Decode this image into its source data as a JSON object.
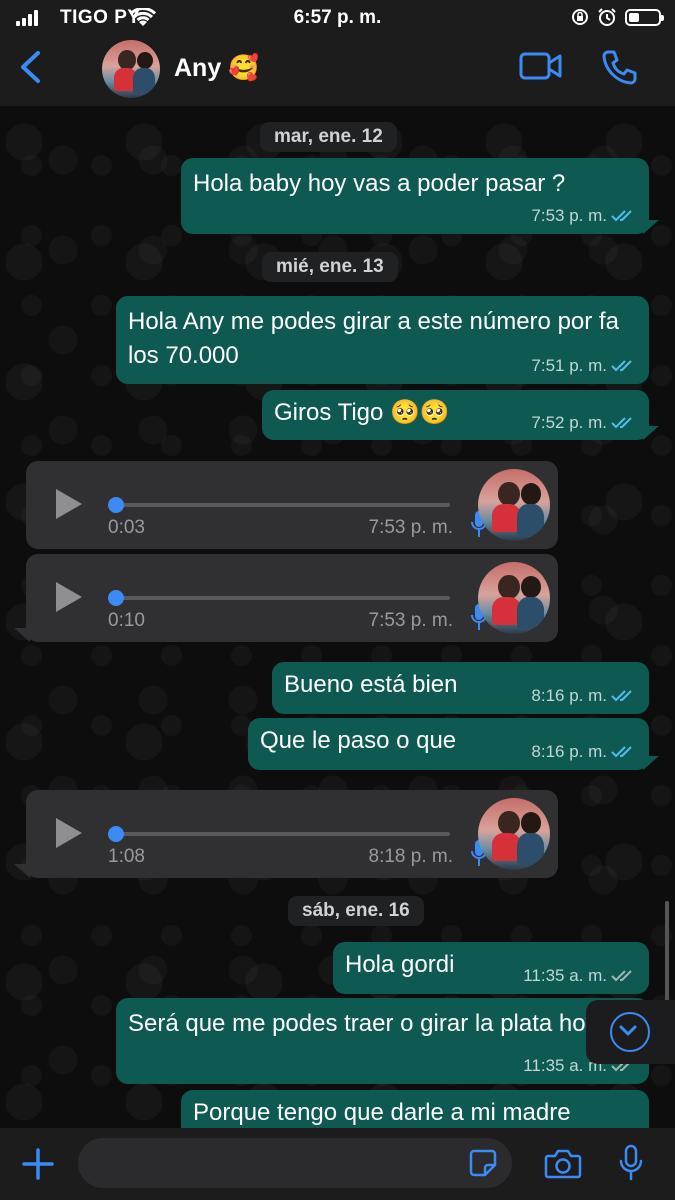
{
  "status": {
    "carrier": "TIGO PY",
    "time": "6:57 p. m."
  },
  "header": {
    "name": "Any 🥰"
  },
  "dates": {
    "d1": "mar, ene. 12",
    "d2": "mié, ene. 13",
    "d3": "sáb, ene. 16"
  },
  "messages": [
    {
      "text": "Hola baby hoy vas a poder pasar ?",
      "time": "7:53 p. m.",
      "read": true
    },
    {
      "text": "Hola Any me podes girar a este número por fa los 70.000",
      "time": "7:51 p. m.",
      "read": true
    },
    {
      "text": "Giros Tigo 🥺🥺",
      "time": "7:52 p. m.",
      "read": true
    },
    {
      "text": "Bueno está bien",
      "time": "8:16 p. m.",
      "read": true
    },
    {
      "text": "Que le paso o que",
      "time": "8:16 p. m.",
      "read": true
    },
    {
      "text": "Hola gordi",
      "time": "11:35 a. m.",
      "read": false
    },
    {
      "text": "Será que me podes traer o girar la plata hoy",
      "time": "11:35 a. m.",
      "read": false
    },
    {
      "text": "Porque tengo que darle a mi madre",
      "time": "",
      "read": false
    }
  ],
  "voice": [
    {
      "duration": "0:03",
      "time": "7:53 p. m.",
      "progress": 0
    },
    {
      "duration": "0:10",
      "time": "7:53 p. m.",
      "progress": 0
    },
    {
      "duration": "1:08",
      "time": "8:18 p. m.",
      "progress": 0
    }
  ],
  "colors": {
    "accent": "#3c8bf5",
    "bubble_out": "#0e5a52",
    "bubble_in": "#303032",
    "read_check": "#53bdeb",
    "unread_check": "#9fb8b3"
  }
}
